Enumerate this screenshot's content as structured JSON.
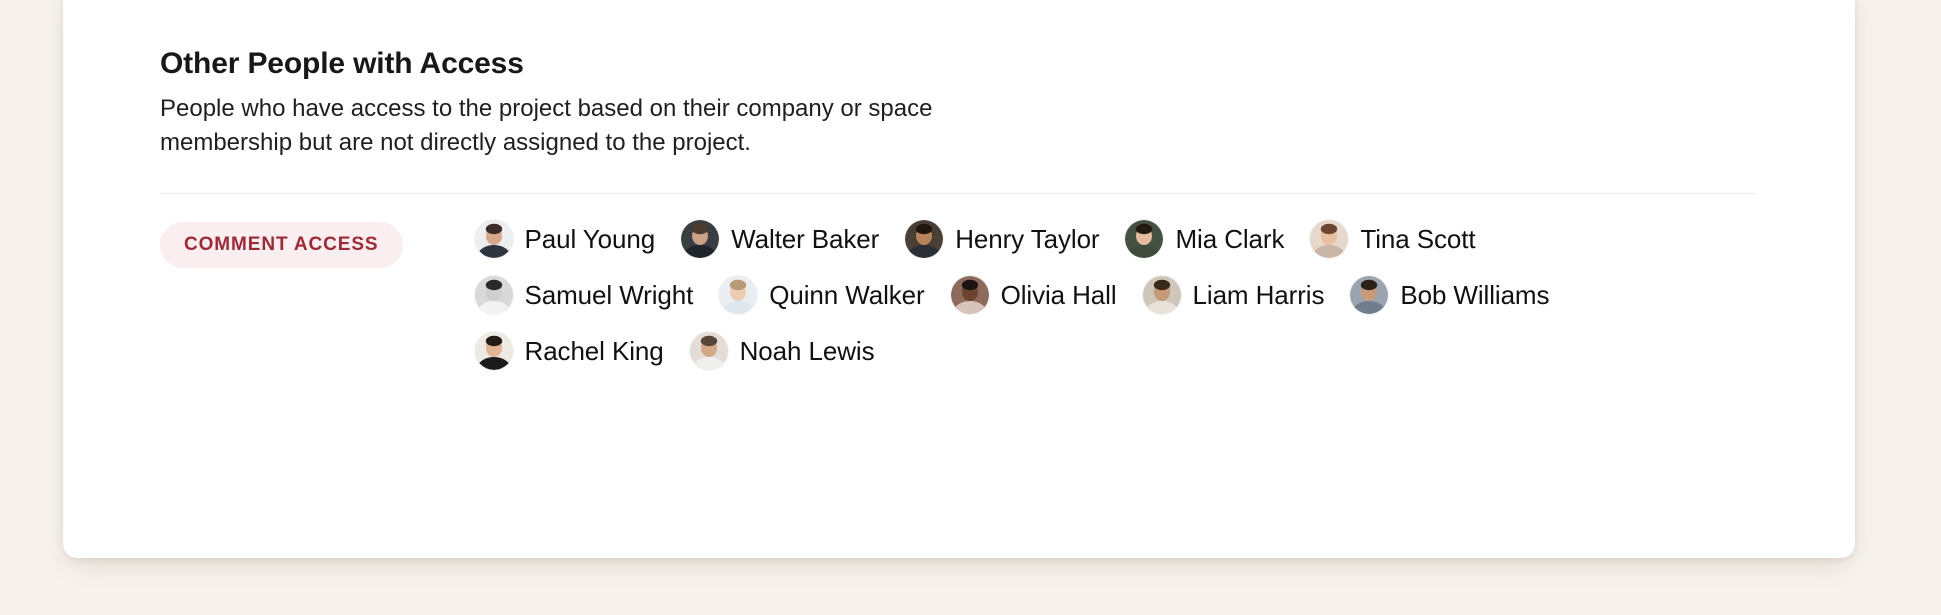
{
  "theme": {
    "page_background": "#f7f2ed",
    "card_background": "#ffffff",
    "badge_background": "#fbeef0",
    "badge_text_color": "#9e2a36",
    "divider_color": "#ececec",
    "title_color": "#18181b",
    "body_text_color": "#1f1f23"
  },
  "section": {
    "title": "Other People with Access",
    "description_line_1": "People who have access to the project based on their company or space",
    "description_line_2": "membership but are not directly assigned to the project."
  },
  "access_group": {
    "badge_label": "COMMENT ACCESS",
    "people": [
      {
        "name": "Paul Young",
        "avatar": "avatar-paul-young",
        "skin": "#d7a98a",
        "hair": "#3b2d25",
        "shirt": "#2f3540",
        "bg": "#eceef0"
      },
      {
        "name": "Walter Baker",
        "avatar": "avatar-walter-baker",
        "skin": "#caa286",
        "hair": "#4b3a2e",
        "shirt": "#20242b",
        "bg": "#3a3d42"
      },
      {
        "name": "Henry Taylor",
        "avatar": "avatar-henry-taylor",
        "skin": "#b98358",
        "hair": "#20160f",
        "shirt": "#2b2f36",
        "bg": "#4a3f35"
      },
      {
        "name": "Mia Clark",
        "avatar": "avatar-mia-clark",
        "skin": "#e3bb9c",
        "hair": "#241a14",
        "shirt": "#3f4b3c",
        "bg": "#45523f"
      },
      {
        "name": "Tina Scott",
        "avatar": "avatar-tina-scott",
        "skin": "#e8c0a0",
        "hair": "#6b4530",
        "shirt": "#c9b6a6",
        "bg": "#e6d8cb"
      },
      {
        "name": "Samuel Wright",
        "avatar": "avatar-samuel-wright",
        "skin": "#cfcfcf",
        "hair": "#2a2a2a",
        "shirt": "#f2f2f2",
        "bg": "#d9d9d9"
      },
      {
        "name": "Quinn Walker",
        "avatar": "avatar-quinn-walker",
        "skin": "#eccdb3",
        "hair": "#b99a72",
        "shirt": "#dfe7ee",
        "bg": "#e9eef3"
      },
      {
        "name": "Olivia Hall",
        "avatar": "avatar-olivia-hall",
        "skin": "#6b4430",
        "hair": "#1c1410",
        "shirt": "#d8c3bb",
        "bg": "#8d6a5c"
      },
      {
        "name": "Liam Harris",
        "avatar": "avatar-liam-harris",
        "skin": "#c59a74",
        "hair": "#3a2a1c",
        "shirt": "#e7e2da",
        "bg": "#cfc6ba"
      },
      {
        "name": "Bob Williams",
        "avatar": "avatar-bob-williams",
        "skin": "#c89a78",
        "hair": "#2c2119",
        "shirt": "#6f7d8c",
        "bg": "#99a4b0"
      },
      {
        "name": "Rachel King",
        "avatar": "avatar-rachel-king",
        "skin": "#e2b493",
        "hair": "#241a16",
        "shirt": "#1b1b1b",
        "bg": "#efe9e3"
      },
      {
        "name": "Noah Lewis",
        "avatar": "avatar-noah-lewis",
        "skin": "#d3a886",
        "hair": "#55463a",
        "shirt": "#efefee",
        "bg": "#e3ddd5"
      }
    ]
  }
}
